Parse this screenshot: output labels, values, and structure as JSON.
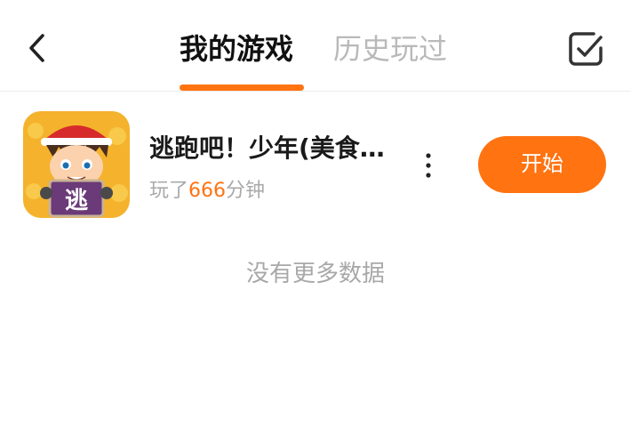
{
  "header": {
    "back_icon": "chevron-left-icon",
    "tabs": [
      {
        "label": "我的游戏",
        "active": true
      },
      {
        "label": "历史玩过",
        "active": false
      }
    ],
    "manage_icon": "checkbox-icon",
    "accent_color": "#ff7311"
  },
  "game": {
    "title": "逃跑吧！少年(美食…",
    "icon_text": "逃",
    "play_time_prefix": "玩了",
    "play_time_value": "666",
    "play_time_suffix": "分钟",
    "more_icon": "more-vertical-icon",
    "start_label": "开始"
  },
  "footer": {
    "no_more_text": "没有更多数据"
  }
}
